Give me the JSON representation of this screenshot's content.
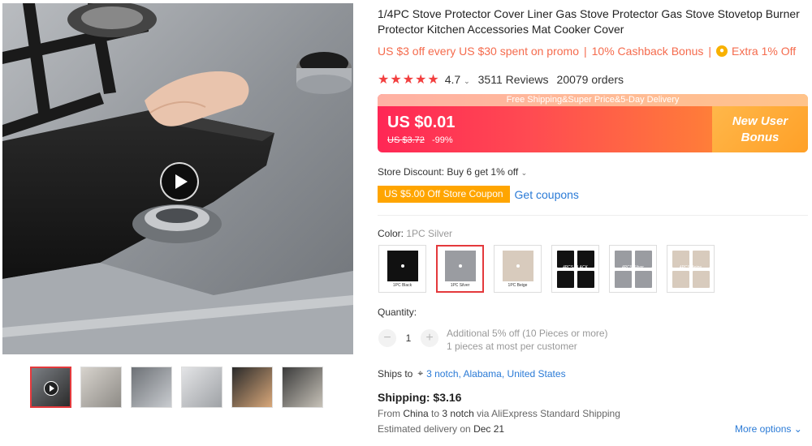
{
  "product": {
    "title": "1/4PC Stove Protector Cover Liner Gas Stove Protector Gas Stove Stovetop Burner Protector Kitchen Accessories Mat Cooker Cover",
    "promo": {
      "item1": "US $3 off every US $30 spent on promo",
      "item2": "10% Cashback Bonus",
      "item3": "Extra 1% Off",
      "separator": "|"
    },
    "rating": {
      "stars": "★★★★★",
      "score": "4.7",
      "reviews": "3511 Reviews",
      "orders": "20079 orders"
    },
    "banner": {
      "topline": "Free Shipping&Super Price&5-Day Delivery",
      "price": "US $0.01",
      "original_price": "US $3.72",
      "discount": "-99%",
      "new_user_line1": "New User",
      "new_user_line2": "Bonus"
    },
    "store_discount": "Store Discount: Buy 6 get 1% off",
    "coupon": "US $5.00 Off Store Coupon",
    "get_coupons": "Get coupons",
    "color_label": "Color:",
    "color_value": "1PC Silver",
    "swatches": [
      {
        "label": "1PC Black",
        "color": "#111111"
      },
      {
        "label": "1PC Silver",
        "color": "#9a9ca1"
      },
      {
        "label": "1PC Beige",
        "color": "#d8cbbd"
      },
      {
        "label": "4PCS BLACK",
        "color": "#111111"
      },
      {
        "label": "4PCS Silver",
        "color": "#9a9ca1"
      },
      {
        "label": "4PCS Beige",
        "color": "#d8cbbd"
      }
    ],
    "quantity_label": "Quantity:",
    "quantity_value": "1",
    "qty_minus": "−",
    "qty_plus": "+",
    "qty_note1": "Additional 5% off (10 Pieces or more)",
    "qty_note2": "1 pieces at most per customer",
    "ships_to_label": "Ships to",
    "ships_to_location": "3 notch, Alabama, United States",
    "shipping": "Shipping: $3.16",
    "ship_from_prefix": "From",
    "ship_from_origin": "China",
    "ship_from_to": "to",
    "ship_from_dest": "3 notch",
    "ship_from_via": "via AliExpress Standard Shipping",
    "est_prefix": "Estimated delivery on",
    "est_date": "Dec 21",
    "more_options": "More options"
  },
  "colors": {
    "accent_red": "#e4393c",
    "promo_orange": "#f56b4d",
    "link_blue": "#2a7ad6",
    "coupon_orange": "#ffa500"
  }
}
